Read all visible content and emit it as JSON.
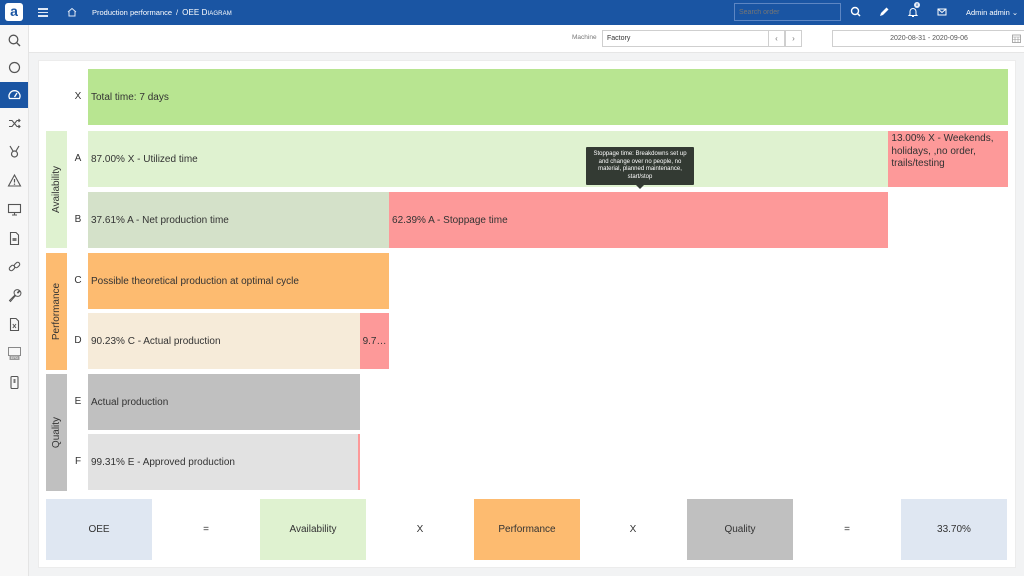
{
  "app": {
    "logo_letter": "a",
    "breadcrumb": {
      "parent": "Production performance",
      "separator": "/",
      "current": "OEE Diagram"
    },
    "search_placeholder": "Search order",
    "notification_count": "8",
    "user_name": "Admin admin",
    "user_chevron": "⌄"
  },
  "sidebar": {
    "items": [
      {
        "icon": "search-icon",
        "active": false
      },
      {
        "icon": "circle-icon",
        "active": false
      },
      {
        "icon": "gauge-icon",
        "active": true
      },
      {
        "icon": "shuffle-icon",
        "active": false
      },
      {
        "icon": "medal-icon",
        "active": false
      },
      {
        "icon": "warning-icon",
        "active": false
      },
      {
        "icon": "monitor-icon",
        "active": false
      },
      {
        "icon": "document-icon",
        "active": false
      },
      {
        "icon": "link-icon",
        "active": false
      },
      {
        "icon": "wrench-icon",
        "active": false
      },
      {
        "icon": "excel-file-icon",
        "active": false
      },
      {
        "icon": "epd-screen-icon",
        "active": false
      },
      {
        "icon": "mobile-device-icon",
        "active": false
      }
    ],
    "epd_label": "EPD"
  },
  "filters": {
    "machine_label": "Machine",
    "machine_value": "Factory",
    "prev_label": "‹",
    "next_label": "›",
    "date_range": "2020-08-31 - 2020-09-06",
    "dropdown_chevron": "⌄"
  },
  "diagram": {
    "groups": [
      {
        "label": "Availability",
        "color": "#dff2d0"
      },
      {
        "label": "Performance",
        "color": "#fdbb70"
      },
      {
        "label": "Quality",
        "color": "#c0c0c0"
      }
    ],
    "rows": [
      {
        "letter": "X",
        "segments": [
          {
            "text": "Total time: 7 days",
            "share": 1.0,
            "offset": 0.0,
            "color": "#b8e591"
          }
        ]
      },
      {
        "letter": "A",
        "segments": [
          {
            "text": "87.00% X - Utilized time",
            "share": 0.87,
            "offset": 0.0,
            "color": "#dff2d0"
          },
          {
            "text": "13.00% X - Weekends, holidays, ,no order, trails/testing",
            "share": 0.13,
            "offset": 0.87,
            "color": "#fd9999",
            "multiline": true
          }
        ]
      },
      {
        "letter": "B",
        "segments": [
          {
            "text": "37.61% A - Net production time",
            "share": 0.3272,
            "offset": 0.0,
            "color": "#d4e1c9"
          },
          {
            "text": "62.39% A - Stoppage time",
            "share": 0.5428,
            "offset": 0.3272,
            "color": "#fd9999"
          }
        ]
      },
      {
        "letter": "C",
        "segments": [
          {
            "text": "Possible theoretical production at optimal cycle",
            "share": 0.3272,
            "offset": 0.0,
            "color": "#fdbb70"
          }
        ]
      },
      {
        "letter": "D",
        "segments": [
          {
            "text": "90.23% C - Actual production",
            "share": 0.2952,
            "offset": 0.0,
            "color": "#f6ebd9"
          },
          {
            "text": "9.7…",
            "share": 0.032,
            "offset": 0.2952,
            "color": "#fd9999"
          }
        ]
      },
      {
        "letter": "E",
        "segments": [
          {
            "text": "Actual production",
            "share": 0.2952,
            "offset": 0.0,
            "color": "#c0c0c0"
          }
        ]
      },
      {
        "letter": "F",
        "segments": [
          {
            "text": "99.31% E - Approved production",
            "share": 0.2932,
            "offset": 0.0,
            "color": "#e2e2e2"
          },
          {
            "text": "",
            "share": 0.002,
            "offset": 0.2932,
            "color": "#fd9999"
          }
        ]
      }
    ],
    "tooltip": "Stoppage time: Breakdowns set up and change over no people, no material, planned maintenance, start/stop"
  },
  "formula": {
    "items": [
      {
        "text": "OEE",
        "color": "#dfe7f2",
        "kind": "box"
      },
      {
        "text": "=",
        "kind": "op"
      },
      {
        "text": "Availability",
        "color": "#dff2d0",
        "kind": "box"
      },
      {
        "text": "X",
        "kind": "op"
      },
      {
        "text": "Performance",
        "color": "#fdbb70",
        "kind": "box"
      },
      {
        "text": "X",
        "kind": "op"
      },
      {
        "text": "Quality",
        "color": "#c0c0c0",
        "kind": "box"
      },
      {
        "text": "=",
        "kind": "op"
      },
      {
        "text": "33.70%",
        "color": "#dfe7f2",
        "kind": "box"
      }
    ]
  }
}
